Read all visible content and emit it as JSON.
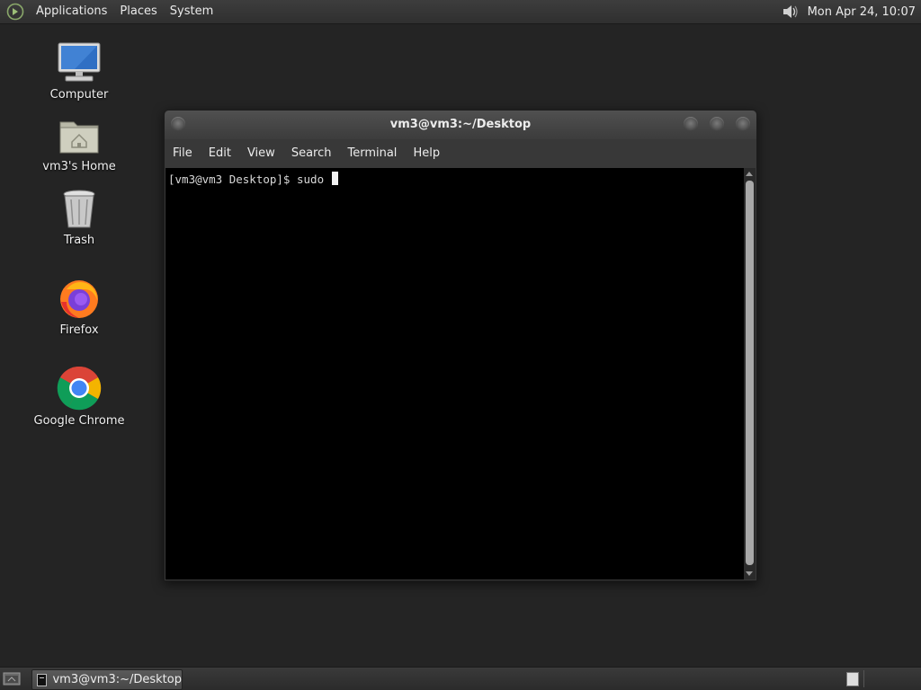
{
  "top_panel": {
    "menus": [
      "Applications",
      "Places",
      "System"
    ],
    "clock": "Mon Apr 24, 10:07",
    "icons": [
      "distro-logo-icon",
      "volume-icon"
    ]
  },
  "desktop_icons": [
    {
      "label": "Computer",
      "icon": "computer-icon"
    },
    {
      "label": "vm3's Home",
      "icon": "home-folder-icon"
    },
    {
      "label": "Trash",
      "icon": "trash-icon"
    },
    {
      "label": "Firefox",
      "icon": "firefox-icon"
    },
    {
      "label": "Google Chrome",
      "icon": "chrome-icon"
    }
  ],
  "terminal": {
    "title": "vm3@vm3:~/Desktop",
    "menu": [
      "File",
      "Edit",
      "View",
      "Search",
      "Terminal",
      "Help"
    ],
    "prompt": "[vm3@vm3 Desktop]$ ",
    "input": "sudo "
  },
  "taskbar": {
    "task_label": "vm3@vm3:~/Desktop"
  },
  "colors": {
    "desktop_bg": "#242424",
    "panel_bg": "#333333",
    "terminal_bg": "#000000",
    "terminal_fg": "#d8d8d8"
  }
}
